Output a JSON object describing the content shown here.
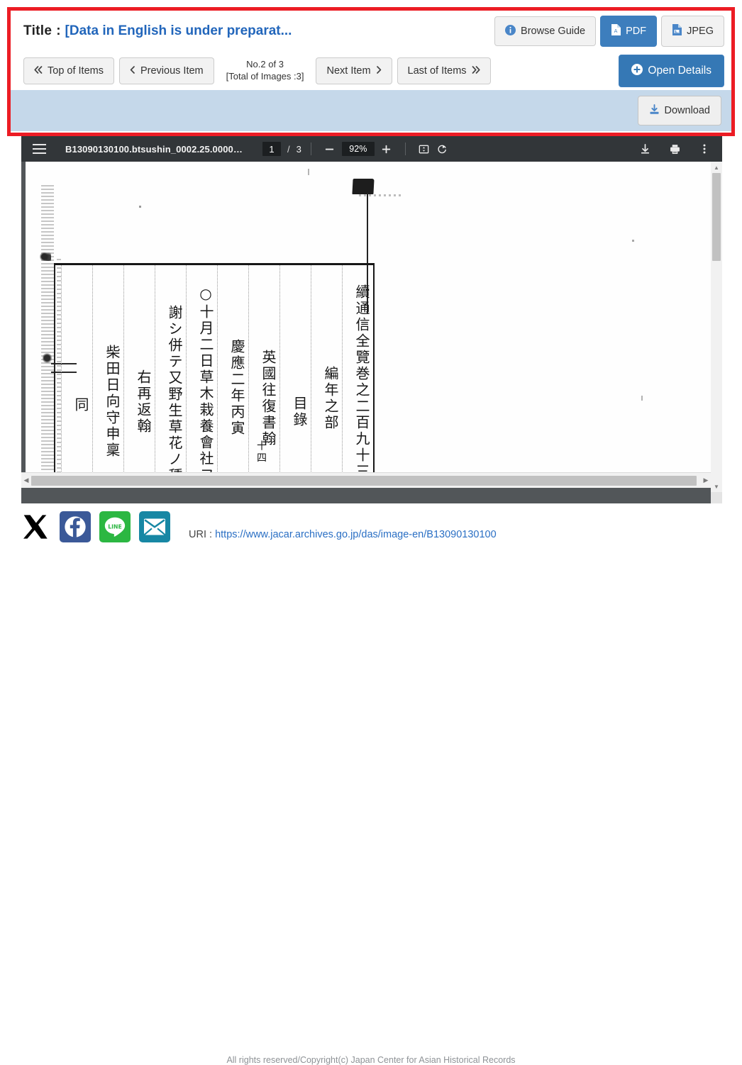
{
  "header": {
    "title_label": "Title",
    "title_separator": ":",
    "title_value": "[Data in English is under preparat...",
    "actions": {
      "browse_guide": "Browse Guide",
      "pdf": "PDF",
      "jpeg": "JPEG"
    }
  },
  "nav": {
    "top_of_items": "Top of Items",
    "previous_item": "Previous Item",
    "counter_line1": "No.2 of 3",
    "counter_line2": "[Total of Images :3]",
    "next_item": "Next Item",
    "last_of_items": "Last of Items",
    "open_details": "Open Details",
    "icons": {
      "top": "double-chevron-left-icon",
      "previous": "chevron-left-icon",
      "next": "chevron-right-icon",
      "last": "double-chevron-right-icon",
      "open_details": "plus-circle-icon"
    }
  },
  "download_bar": {
    "download": "Download",
    "icon": "download-icon",
    "background": "#c5d8ea"
  },
  "pdf_toolbar": {
    "menu_icon": "hamburger-menu-icon",
    "filename": "B13090130100.btsushin_0002.25.0000…",
    "page_current": "1",
    "page_separator": "/",
    "page_total": "3",
    "zoom_out_icon": "minus-icon",
    "zoom_level": "92%",
    "zoom_in_icon": "plus-icon",
    "fit_page_icon": "fit-page-icon",
    "rotate_icon": "rotate-icon",
    "download_icon": "download-icon",
    "print_icon": "print-icon",
    "more_icon": "kebab-menu-icon"
  },
  "document": {
    "columns": [
      "續通信全覽巻之二百九十三",
      "編年之部",
      "目錄",
      "英國往復書翰",
      "十四",
      "慶應二年丙寅",
      "○十月二日草木栽養會社ヲ",
      "謝シ併テ又野生草花ノ種",
      "右再返翰",
      "柴田日向守申稟",
      "同"
    ]
  },
  "footer": {
    "share_icons": [
      {
        "name": "x-twitter-icon",
        "color": "#ffffff"
      },
      {
        "name": "facebook-icon",
        "color": "#3b5998"
      },
      {
        "name": "line-icon",
        "color": "#2cb742"
      },
      {
        "name": "email-icon",
        "color": "#1787a4"
      }
    ],
    "line_label": "LINE",
    "uri_label": "URI",
    "uri_separator": ":",
    "uri_value": "https://www.jacar.archives.go.jp/das/image-en/B13090130100",
    "copyright": "All rights reserved/Copyright(c) Japan Center for Asian Historical Records"
  },
  "colors": {
    "highlight_border": "#ec1c24",
    "primary_blue": "#3d7ebd",
    "link_blue": "#2266bb",
    "toolbar_dark": "#323639"
  }
}
